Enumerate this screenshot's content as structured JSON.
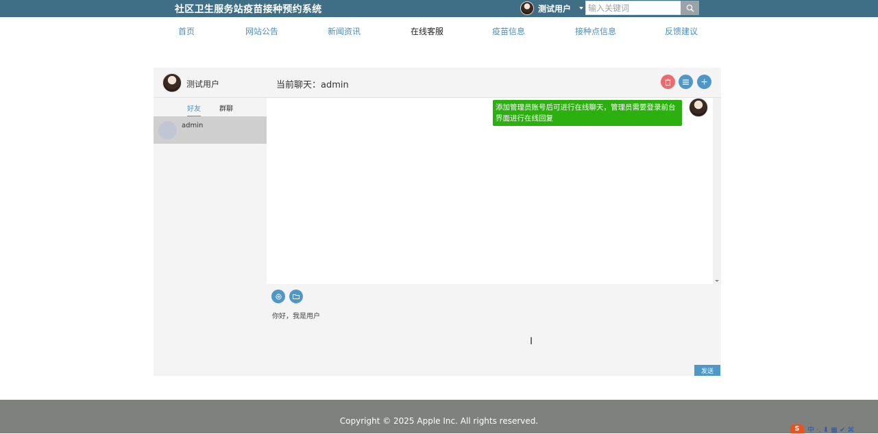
{
  "header": {
    "site_title": "社区卫生服务站疫苗接种预约系统",
    "username": "测试用户",
    "search_placeholder": "输入关键词"
  },
  "nav": {
    "items": [
      {
        "label": "首页"
      },
      {
        "label": "网站公告"
      },
      {
        "label": "新闻资讯"
      },
      {
        "label": "在线客服",
        "active": true
      },
      {
        "label": "疫苗信息"
      },
      {
        "label": "接种点信息"
      },
      {
        "label": "反馈建议"
      }
    ]
  },
  "chat": {
    "me_name": "测试用户",
    "current_chat": "当前聊天：admin",
    "tabs": [
      {
        "label": "好友",
        "active": true
      },
      {
        "label": "群聊",
        "active": false
      }
    ],
    "contacts": [
      {
        "name": "admin"
      }
    ],
    "messages": [
      {
        "text": "添加管理员账号后可进行在线聊天，管理员需要登录前台界面进行在线回复",
        "from": "me"
      }
    ],
    "input_value": "你好，我是用户",
    "send_label": "发送"
  },
  "footer": {
    "copyright": "Copyright © 2025 Apple Inc. All rights reserved."
  },
  "ime": {
    "logo": "S",
    "status": "中 ·, ⬇ ▦ ✔ ⌘"
  },
  "colors": {
    "topbar": "#3f6f86",
    "nav_link": "#4f8fbf",
    "bubble": "#2bb00f",
    "accent": "#4e97c7",
    "danger": "#ee6b6b",
    "footer": "#7f817e"
  }
}
